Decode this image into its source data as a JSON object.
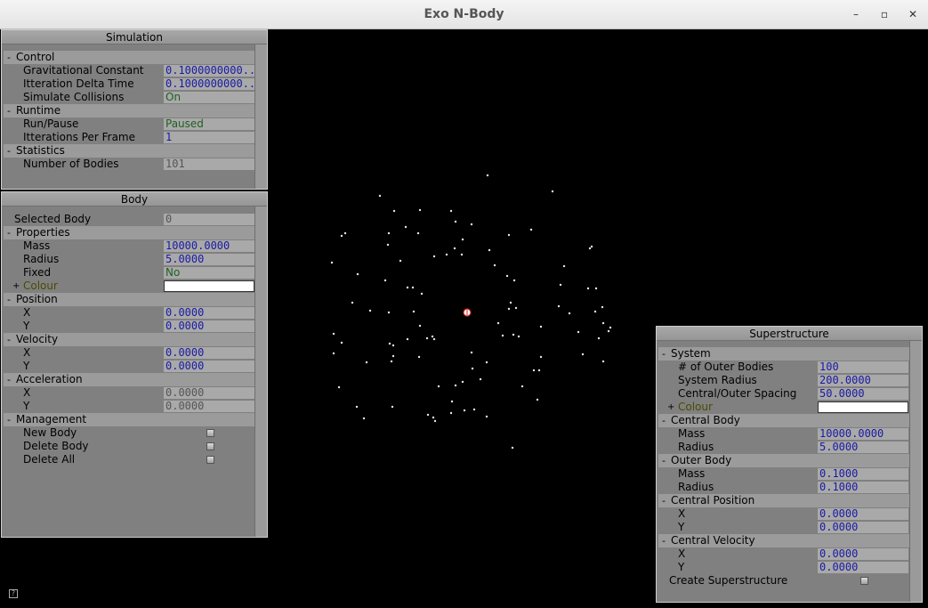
{
  "window": {
    "title": "Exo N-Body"
  },
  "simulation_panel": {
    "title": "Simulation",
    "groups": {
      "control": "Control",
      "runtime": "Runtime",
      "statistics": "Statistics"
    },
    "rows": {
      "grav_label": "Gravitational Constant",
      "grav_value": "0.1000000000..",
      "delta_label": "Itteration Delta Time",
      "delta_value": "0.1000000000..",
      "collisions_label": "Simulate Collisions",
      "collisions_value": "On",
      "runpause_label": "Run/Pause",
      "runpause_value": "Paused",
      "ipf_label": "Itterations Per Frame",
      "ipf_value": "1",
      "nbodies_label": "Number of Bodies",
      "nbodies_value": "101"
    }
  },
  "body_panel": {
    "title": "Body",
    "selected_label": "Selected Body",
    "selected_value": "0",
    "groups": {
      "properties": "Properties",
      "position": "Position",
      "velocity": "Velocity",
      "acceleration": "Acceleration",
      "management": "Management"
    },
    "mass_label": "Mass",
    "mass_value": "10000.0000",
    "radius_label": "Radius",
    "radius_value": "5.0000",
    "fixed_label": "Fixed",
    "fixed_value": "No",
    "colour_label": "Colour",
    "pos_x_label": "X",
    "pos_x_value": "0.0000",
    "pos_y_label": "Y",
    "pos_y_value": "0.0000",
    "vel_x_label": "X",
    "vel_x_value": "0.0000",
    "vel_y_label": "Y",
    "vel_y_value": "0.0000",
    "acc_x_label": "X",
    "acc_x_value": "0.0000",
    "acc_y_label": "Y",
    "acc_y_value": "0.0000",
    "new_body": "New Body",
    "delete_body": "Delete Body",
    "delete_all": "Delete All"
  },
  "superstructure_panel": {
    "title": "Superstructure",
    "groups": {
      "system": "System",
      "central_body": "Central Body",
      "outer_body": "Outer Body",
      "central_position": "Central Position",
      "central_velocity": "Central Velocity"
    },
    "outer_count_label": "# of Outer Bodies",
    "outer_count_value": "100",
    "system_radius_label": "System Radius",
    "system_radius_value": "200.0000",
    "spacing_label": "Central/Outer Spacing",
    "spacing_value": "50.0000",
    "colour_label": "Colour",
    "cb_mass_label": "Mass",
    "cb_mass_value": "10000.0000",
    "cb_radius_label": "Radius",
    "cb_radius_value": "5.0000",
    "ob_mass_label": "Mass",
    "ob_mass_value": "0.1000",
    "ob_radius_label": "Radius",
    "ob_radius_value": "0.1000",
    "cp_x_label": "X",
    "cp_x_value": "0.0000",
    "cp_y_label": "Y",
    "cp_y_value": "0.0000",
    "cv_x_label": "X",
    "cv_x_value": "0.0000",
    "cv_y_label": "Y",
    "cv_y_value": "0.0000",
    "create_label": "Create Superstructure"
  },
  "colors": {
    "background": "#000000",
    "panel": "#808080",
    "value_blue": "#1a1aa6",
    "value_green": "#1f5f1f",
    "central_body_marker": "#cc2222",
    "body_dot": "#e6e6e6"
  },
  "icons": {
    "minimize": "minimize-icon",
    "maximize": "maximize-icon",
    "close": "close-icon",
    "help": "help-icon"
  }
}
